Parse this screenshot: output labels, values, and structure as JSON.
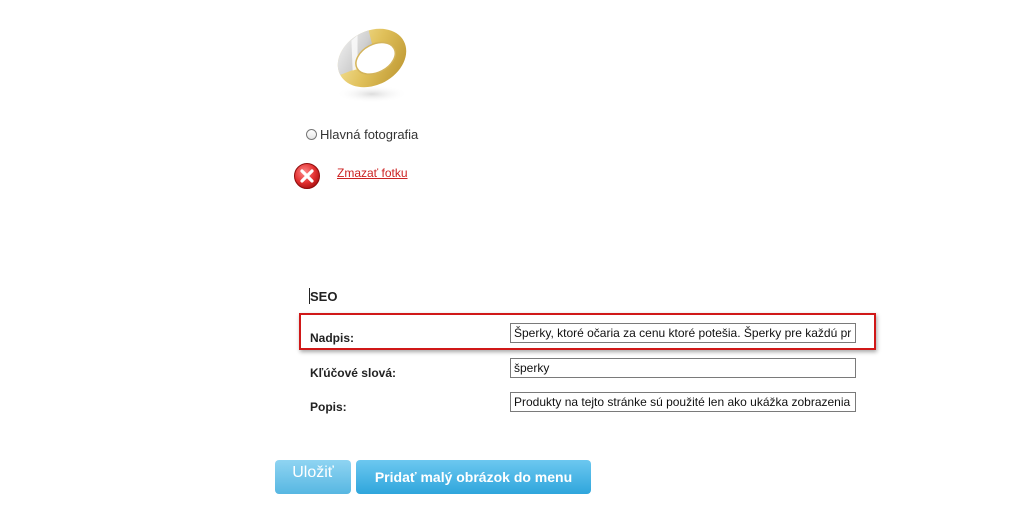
{
  "photo": {
    "image_name": "gold-ring-icon",
    "main_photo_label": "Hlavná fotografia",
    "delete_label": "Zmazať fotku"
  },
  "seo": {
    "section_title": "SEO",
    "fields": [
      {
        "label": "Nadpis:",
        "value": "Šperky, ktoré očaria za cenu ktoré potešia. Šperky pre každú pri"
      },
      {
        "label": "Kľúčové slová:",
        "value": "šperky"
      },
      {
        "label": "Popis:",
        "value": "Produkty na tejto stránke sú použité len ako ukážka zobrazenia"
      }
    ]
  },
  "actions": {
    "save_label": "Uložiť",
    "add_menu_image_label": "Pridať malý obrázok do menu"
  },
  "colors": {
    "button_blue": "#2fa6dc",
    "highlight_red": "#d01818",
    "link_red": "#cc2222"
  }
}
